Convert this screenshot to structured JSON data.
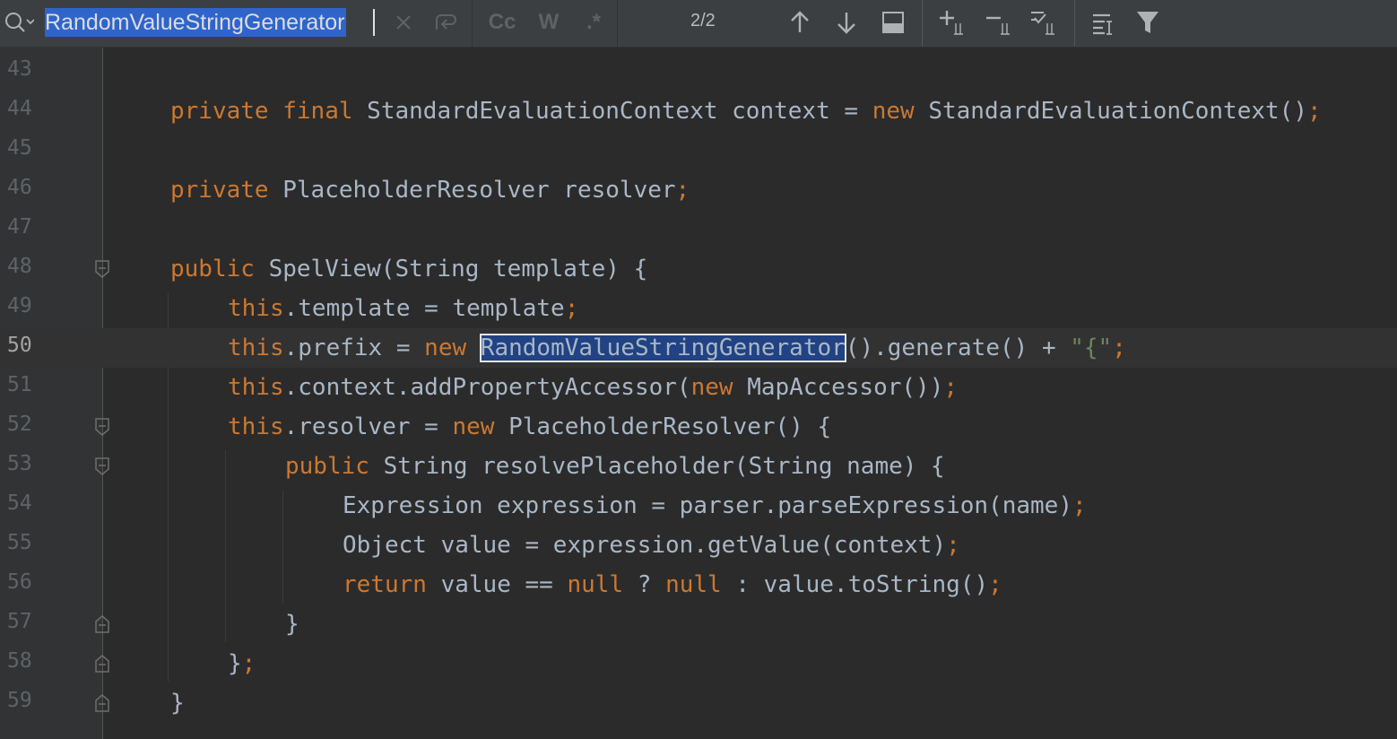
{
  "find_bar": {
    "query": "RandomValueStringGenerator",
    "match_case_label": "Cc",
    "words_label": "W",
    "regex_label": ".*",
    "match_count": "2/2"
  },
  "editor": {
    "current_line": "50",
    "lines": [
      {
        "num": "43"
      },
      {
        "num": "44"
      },
      {
        "num": "45"
      },
      {
        "num": "46"
      },
      {
        "num": "47"
      },
      {
        "num": "48"
      },
      {
        "num": "49"
      },
      {
        "num": "50"
      },
      {
        "num": "51"
      },
      {
        "num": "52"
      },
      {
        "num": "53"
      },
      {
        "num": "54"
      },
      {
        "num": "55"
      },
      {
        "num": "56"
      },
      {
        "num": "57"
      },
      {
        "num": "58"
      },
      {
        "num": "59"
      }
    ],
    "tokens": {
      "l44": [
        "private",
        "final",
        "StandardEvaluationContext context = ",
        "new",
        "StandardEvaluationContext()",
        ";"
      ],
      "l46": [
        "private",
        "PlaceholderResolver resolver",
        ";"
      ],
      "l48": [
        "public",
        "SpelView(String template) {"
      ],
      "l49": [
        "this",
        ".template = template",
        ";"
      ],
      "l50": [
        "this",
        ".prefix = ",
        "new",
        "RandomValueStringGenerator",
        "().generate() + ",
        "\"{\"",
        ";"
      ],
      "l51": [
        "this",
        ".context.addPropertyAccessor(",
        "new",
        "MapAccessor())",
        ";"
      ],
      "l52": [
        "this",
        ".resolver = ",
        "new",
        "PlaceholderResolver() {"
      ],
      "l53": [
        "public",
        "String resolvePlaceholder(String name) {"
      ],
      "l54": [
        "Expression expression = parser.parseExpression(name)",
        ";"
      ],
      "l55": [
        "Object value = expression.getValue(context)",
        ";"
      ],
      "l56": [
        "return",
        "value == ",
        "null",
        "?",
        "null",
        ": value.toString()",
        ";"
      ],
      "l57": [
        "}"
      ],
      "l58": [
        "}",
        ";"
      ],
      "l59": [
        "}"
      ]
    }
  },
  "colors": {
    "keyword": "#cc7832",
    "identifier": "#a9b7c6",
    "string": "#6a8759",
    "search_highlight": "#214283"
  }
}
